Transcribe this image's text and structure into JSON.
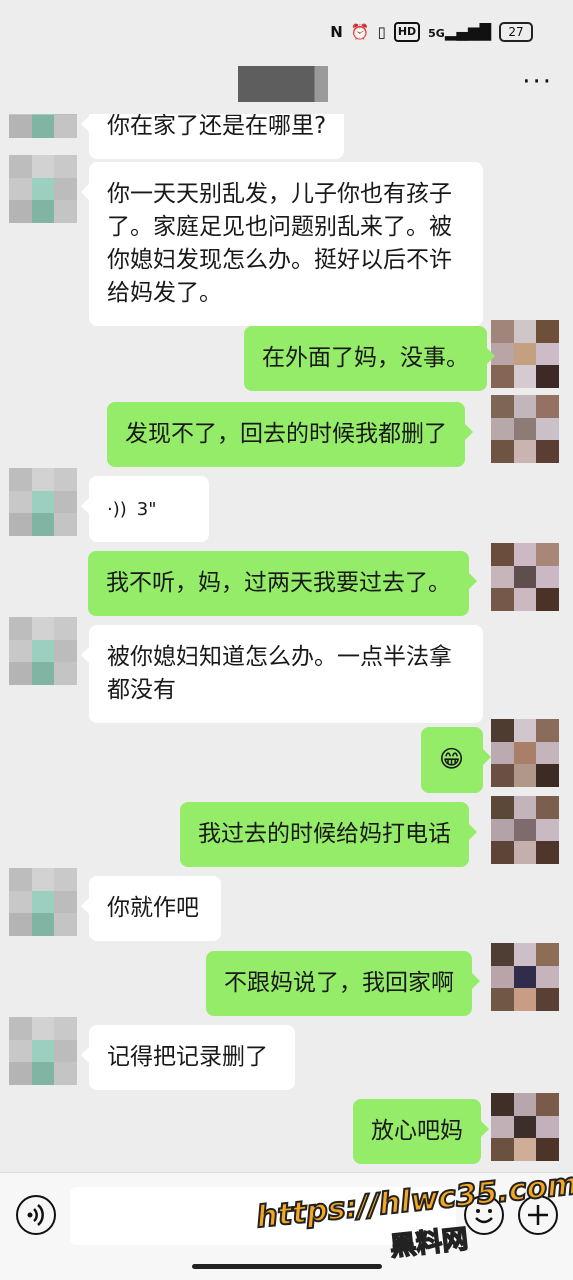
{
  "status_bar": {
    "nfc": "N",
    "alarm": "⏰",
    "vibrate": "▯",
    "hd": "HD",
    "signal": "5G",
    "battery": "27"
  },
  "header": {
    "more": "···"
  },
  "colors": {
    "my_bubble": "#95ec69",
    "their_bubble": "#ffffff",
    "background": "#ededed"
  },
  "messages": [
    {
      "side": "left",
      "type": "text",
      "text": "你在家了还是在哪里?"
    },
    {
      "side": "left",
      "type": "text",
      "text": "你一天天别乱发，儿子你也有孩子\n了。家庭足见也问题别乱来了。被\n你媳妇发现怎么办。挺好以后不许\n给妈发了。"
    },
    {
      "side": "right",
      "type": "text",
      "text": "在外面了妈，没事。"
    },
    {
      "side": "right",
      "type": "text",
      "text": "发现不了，回去的时候我都删了"
    },
    {
      "side": "left",
      "type": "voice",
      "text": "3\""
    },
    {
      "side": "right",
      "type": "text",
      "text": "我不听，妈，过两天我要过去了。"
    },
    {
      "side": "left",
      "type": "text",
      "text": "被你媳妇知道怎么办。一点半法拿\n都没有"
    },
    {
      "side": "right",
      "type": "emoji",
      "text": "😁"
    },
    {
      "side": "right",
      "type": "text",
      "text": "我过去的时候给妈打电话"
    },
    {
      "side": "left",
      "type": "text",
      "text": "你就作吧"
    },
    {
      "side": "right",
      "type": "text",
      "text": "不跟妈说了，我回家啊"
    },
    {
      "side": "left",
      "type": "text",
      "text": "记得把记录删了"
    },
    {
      "side": "right",
      "type": "text",
      "text": "放心吧妈"
    }
  ],
  "input_bar": {
    "voice_icon": "voice-icon",
    "emoji_icon": "emoji-icon",
    "plus_icon": "plus-icon"
  },
  "watermark": {
    "url": "https://hlwc35.com",
    "name": "黑料网"
  }
}
